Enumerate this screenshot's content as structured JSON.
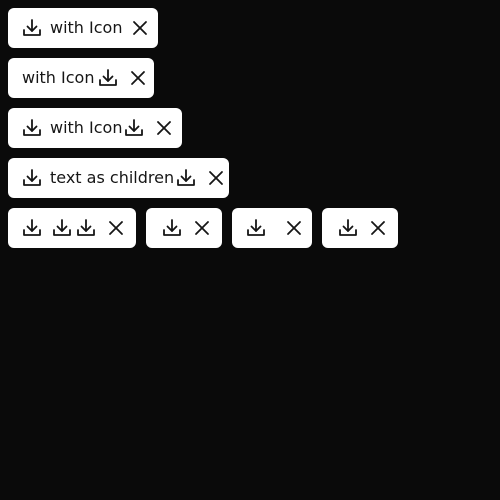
{
  "chips": [
    {
      "label": "with Icon",
      "icon_leading": "download-icon",
      "icon_close": "close-icon"
    },
    {
      "label": "with Icon",
      "icon_trailing": "download-icon",
      "icon_close": "close-icon"
    },
    {
      "label": "with Icon",
      "icon_leading": "download-icon",
      "icon_trailing": "download-icon",
      "icon_close": "close-icon"
    },
    {
      "label": "text as children",
      "icon_leading": "download-icon",
      "icon_trailing": "download-icon",
      "icon_close": "close-icon"
    }
  ],
  "icon_only_chips": [
    {
      "icons": [
        "download-icon",
        "download-icon",
        "download-icon"
      ],
      "icon_close": "close-icon"
    },
    {
      "icons": [
        "download-icon"
      ],
      "icon_close": "close-icon"
    },
    {
      "icons": [
        "download-icon"
      ],
      "icon_close": "close-icon"
    },
    {
      "icons": [
        "download-icon"
      ],
      "icon_close": "close-icon"
    }
  ],
  "colors": {
    "background": "#0a0a0a",
    "chip_background": "#ffffff",
    "text": "#161616"
  }
}
